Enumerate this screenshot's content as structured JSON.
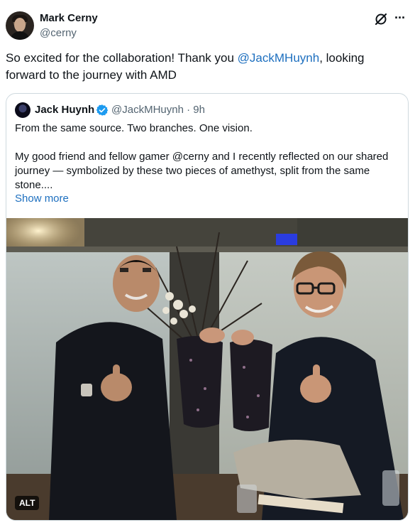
{
  "post": {
    "author_name": "Mark Cerny",
    "author_handle": "@cerny",
    "text_before": "So excited for the collaboration! Thank you ",
    "mention": "@JackMHuynh",
    "text_after": ", looking forward to the journey with AMD",
    "grok_icon": "grok-icon",
    "more_icon": "more-icon",
    "more_glyph": "···"
  },
  "quote": {
    "author_name": "Jack Huynh",
    "author_handle": "@JackMHuynh · 9h",
    "verified_icon": "verified-badge-icon",
    "verified_color": "#1d9bf0",
    "text": "From the same source.  Two branches.  One vision.\n\nMy good friend and fellow gamer @cerny and I recently reflected on our shared journey — symbolized by these two pieces of amethyst, split from the same stone....",
    "show_more": "Show more",
    "alt_label": "ALT"
  },
  "colors": {
    "link": "#1d6fbf",
    "secondary_text": "#536471",
    "border": "#cfd9de"
  }
}
